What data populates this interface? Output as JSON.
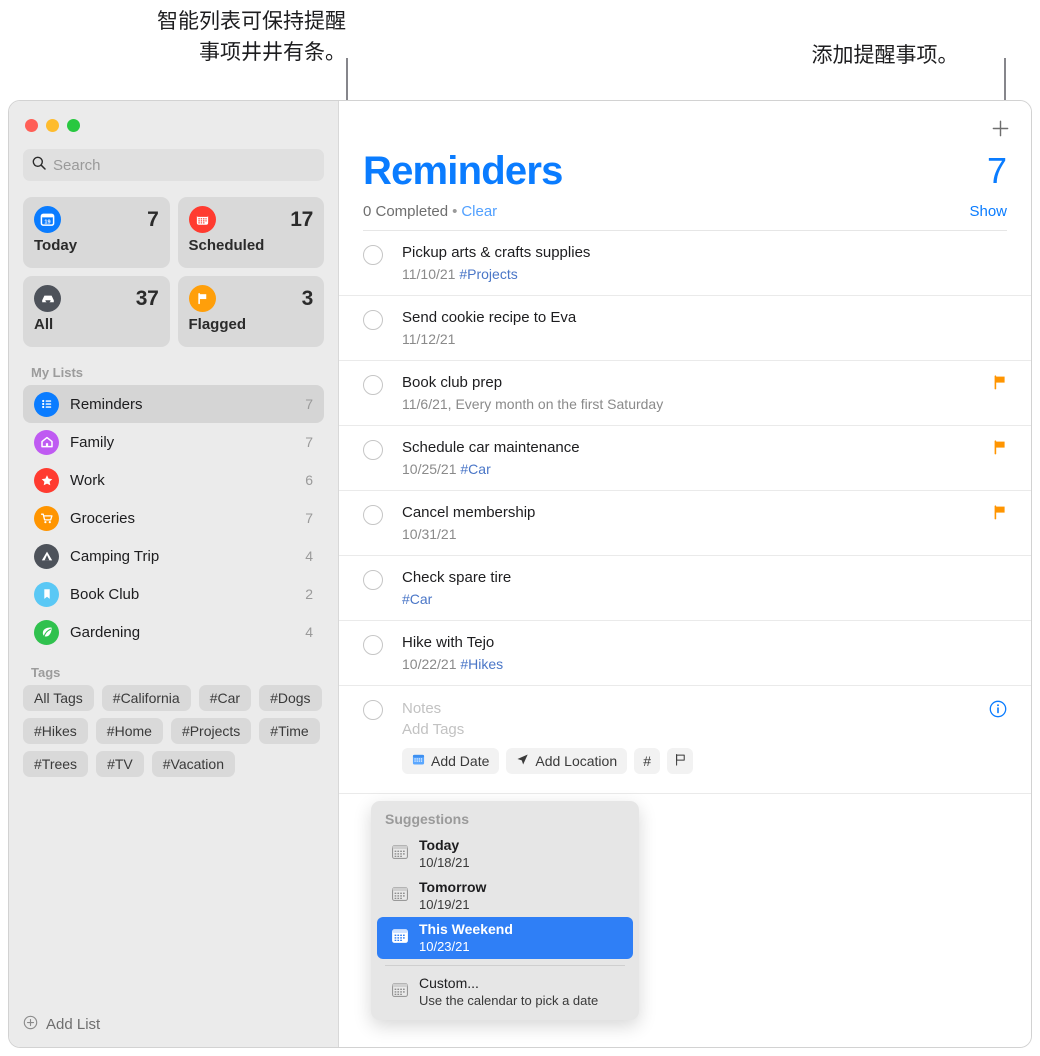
{
  "callouts": {
    "left": "智能列表可保持提醒\n事项井井有条。",
    "right": "添加提醒事项。"
  },
  "window": {
    "traffic_lights": [
      {
        "name": "close",
        "color": "#ff5f57"
      },
      {
        "name": "minimize",
        "color": "#febc2e"
      },
      {
        "name": "maximize",
        "color": "#28c840"
      }
    ]
  },
  "sidebar": {
    "search": {
      "placeholder": "Search",
      "value": "",
      "icon": "search-icon"
    },
    "smart_lists": [
      {
        "id": "today",
        "label": "Today",
        "count": "7",
        "icon": "calendar-day-icon",
        "color": "#0a7cff"
      },
      {
        "id": "scheduled",
        "label": "Scheduled",
        "count": "17",
        "icon": "calendar-icon",
        "color": "#ff3b30"
      },
      {
        "id": "all",
        "label": "All",
        "count": "37",
        "icon": "tray-icon",
        "color": "#4d525a"
      },
      {
        "id": "flagged",
        "label": "Flagged",
        "count": "3",
        "icon": "flag-icon",
        "color": "#ff9f0a"
      }
    ],
    "my_lists_header": "My Lists",
    "my_lists": [
      {
        "label": "Reminders",
        "count": "7",
        "icon": "bulleted-list-icon",
        "color": "#0a7cff",
        "selected": true
      },
      {
        "label": "Family",
        "count": "7",
        "icon": "house-icon",
        "color": "#bf5af2",
        "selected": false
      },
      {
        "label": "Work",
        "count": "6",
        "icon": "star-icon",
        "color": "#ff3b30",
        "selected": false
      },
      {
        "label": "Groceries",
        "count": "7",
        "icon": "cart-icon",
        "color": "#ff9500",
        "selected": false
      },
      {
        "label": "Camping Trip",
        "count": "4",
        "icon": "tent-icon",
        "color": "#4d525a",
        "selected": false
      },
      {
        "label": "Book Club",
        "count": "2",
        "icon": "bookmark-icon",
        "color": "#5ac8f5",
        "selected": false
      },
      {
        "label": "Gardening",
        "count": "4",
        "icon": "leaf-icon",
        "color": "#30c14e",
        "selected": false
      }
    ],
    "tags_header": "Tags",
    "tags": [
      "All Tags",
      "#California",
      "#Car",
      "#Dogs",
      "#Hikes",
      "#Home",
      "#Projects",
      "#Time",
      "#Trees",
      "#TV",
      "#Vacation"
    ],
    "add_list": {
      "label": "Add List",
      "icon": "plus-circle-icon"
    }
  },
  "main": {
    "add_button": {
      "icon": "plus-icon",
      "label": "+"
    },
    "title": "Reminders",
    "count": "7",
    "completed_text": "0 Completed",
    "separator": "•",
    "clear_label": "Clear",
    "show_label": "Show",
    "accent_color": "#0a7cff",
    "reminders": [
      {
        "title": "Pickup arts & crafts supplies",
        "date": "11/10/21",
        "tag": "#Projects",
        "flagged": false
      },
      {
        "title": "Send cookie recipe to Eva",
        "date": "11/12/21",
        "tag": "",
        "flagged": false
      },
      {
        "title": "Book club prep",
        "date": "11/6/21, Every month on the first Saturday",
        "tag": "",
        "flagged": true
      },
      {
        "title": "Schedule car maintenance",
        "date": "10/25/21",
        "tag": "#Car",
        "flagged": true
      },
      {
        "title": "Cancel membership",
        "date": "10/31/21",
        "tag": "",
        "flagged": true
      },
      {
        "title": "Check spare tire",
        "date": "",
        "tag": "#Car",
        "flagged": false
      },
      {
        "title": "Hike with Tejo",
        "date": "10/22/21",
        "tag": "#Hikes",
        "flagged": false
      }
    ],
    "editor": {
      "title_value": "",
      "notes_placeholder": "Notes",
      "tags_placeholder": "Add Tags",
      "buttons": [
        {
          "label": "Add Date",
          "icon": "calendar-small-icon"
        },
        {
          "label": "Add Location",
          "icon": "location-arrow-icon"
        },
        {
          "label": "#",
          "icon": "hash-icon"
        },
        {
          "label": "",
          "icon": "flag-outline-icon"
        }
      ],
      "info_icon": "info-circle-icon"
    }
  },
  "suggestions": {
    "header": "Suggestions",
    "items": [
      {
        "title": "Today",
        "sub": "10/18/21",
        "icon": "calendar-small-icon",
        "active": false
      },
      {
        "title": "Tomorrow",
        "sub": "10/19/21",
        "icon": "calendar-small-icon",
        "active": false
      },
      {
        "title": "This Weekend",
        "sub": "10/23/21",
        "icon": "calendar-small-icon",
        "active": true
      },
      {
        "title": "Custom...",
        "sub": "Use the calendar to pick a date",
        "icon": "calendar-small-icon",
        "active": false
      }
    ]
  }
}
